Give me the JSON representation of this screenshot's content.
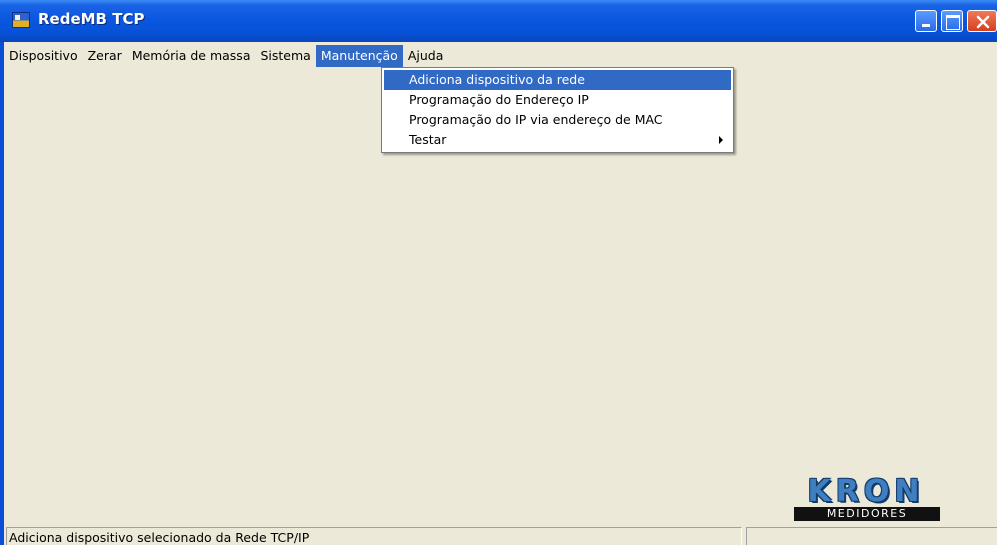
{
  "window": {
    "title": "RedeMB TCP",
    "icon": "app-icon"
  },
  "menubar": {
    "items": [
      {
        "label": "Dispositivo"
      },
      {
        "label": "Zerar"
      },
      {
        "label": "Memória de massa"
      },
      {
        "label": "Sistema"
      },
      {
        "label": "Manutenção",
        "active": true
      },
      {
        "label": "Ajuda"
      }
    ]
  },
  "dropdown": {
    "items": [
      {
        "label": "Adiciona dispositivo da rede",
        "selected": true
      },
      {
        "label": "Programação do Endereço IP"
      },
      {
        "label": "Programação do IP via endereço de MAC"
      },
      {
        "label": "Testar",
        "submenu": true
      }
    ]
  },
  "logo": {
    "top": "KRON",
    "bottom": "MEDIDORES"
  },
  "statusbar": {
    "text": "Adiciona dispositivo selecionado da Rede TCP/IP",
    "right": ""
  },
  "colors": {
    "title_bar": "#0a58e0",
    "highlight": "#316ac5",
    "background": "#ece9d8",
    "logo_blue": "#3f7fc0"
  }
}
